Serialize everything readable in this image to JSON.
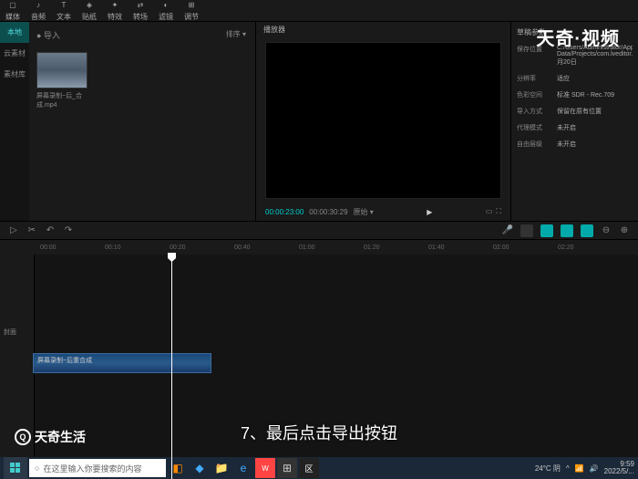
{
  "toolbar": {
    "items": [
      {
        "label": "媒体",
        "icon": "▢"
      },
      {
        "label": "音频",
        "icon": "♪"
      },
      {
        "label": "文本",
        "icon": "T"
      },
      {
        "label": "贴纸",
        "icon": "◈"
      },
      {
        "label": "特效",
        "icon": "✦"
      },
      {
        "label": "转场",
        "icon": "⇄"
      },
      {
        "label": "滤镜",
        "icon": "◐"
      },
      {
        "label": "调节",
        "icon": "⊞"
      }
    ]
  },
  "media": {
    "tabs": [
      "本地",
      "云素材",
      "素材库"
    ],
    "import": "● 导入",
    "sort": "排序 ▾",
    "thumb_label": "屏幕录制~后_合成.mp4"
  },
  "preview": {
    "header": "播放器",
    "timecode1": "00:00:23:00",
    "timecode2": "00:00:30:29",
    "ratio": "原始 ▾",
    "play": "▶"
  },
  "props": {
    "header": "草稿参数",
    "rows": [
      {
        "label": "保存位置",
        "value": "C:/Users/Administrator/AppData/Local/JianyingPro/User Data/Projects/com.lveditor.draft/6月20日"
      },
      {
        "label": "分辨率",
        "value": "适应"
      },
      {
        "label": "色彩空间",
        "value": "标准 SDR - Rec.709"
      },
      {
        "label": "导入方式",
        "value": "保留在原有位置"
      },
      {
        "label": "代理模式",
        "value": "未开启"
      },
      {
        "label": "自由层级",
        "value": "未开启"
      }
    ]
  },
  "watermark": "天奇·视频",
  "timeline": {
    "ticks": [
      "00:00",
      "00:10",
      "00:20",
      "00:40",
      "01:00",
      "01:20",
      "01:40",
      "02:00",
      "02:20"
    ],
    "track_label": "封面",
    "clip_label": "屏幕录制~后重合成"
  },
  "caption": "7、最后点击导出按钮",
  "logo": "天奇生活",
  "taskbar": {
    "search_placeholder": "在这里输入你要搜索的内容",
    "weather": "24°C 阴",
    "time": "9:59",
    "date": "2022/5/..."
  }
}
